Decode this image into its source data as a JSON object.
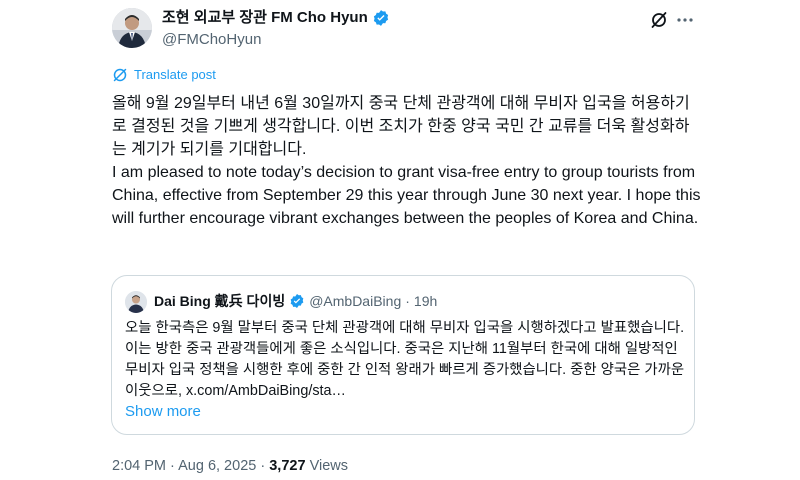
{
  "author": {
    "display_name": "조현 외교부 장관 FM Cho Hyun",
    "handle": "@FMChoHyun"
  },
  "translate_label": "Translate post",
  "body": {
    "korean": "올해 9월 29일부터 내년 6월 30일까지 중국 단체 관광객에 대해 무비자 입국을 허용하기로 결정된 것을 기쁘게 생각합니다. 이번 조치가 한중 양국 국민 간 교류를 더욱 활성화하는 계기가 되기를 기대합니다.",
    "english": "I am pleased to note today’s decision to grant visa-free entry to group tourists from China, effective from September 29 this year through June 30 next year. I hope this will further encourage vibrant exchanges between the peoples of Korea and China."
  },
  "quote": {
    "display_name": "Dai Bing 戴兵 다이빙",
    "handle": "@AmbDaiBing",
    "separator": "·",
    "time": "19h",
    "text": "오늘 한국측은 9월 말부터 중국 단체 관광객에 대해 무비자 입국을 시행하겠다고 발표했습니다. 이는 방한 중국 관광객들에게 좋은 소식입니다. 중국은 지난해 11월부터 한국에 대해 일방적인 무비자 입국 정책을 시행한 후에 중한 간 인적 왕래가 빠르게 증가했습니다. 중한 양국은 가까운 이웃으로, x.com/AmbDaiBing/sta…",
    "show_more": "Show more"
  },
  "meta": {
    "time": "2:04 PM",
    "separator": "·",
    "date": "Aug 6, 2025",
    "separator2": "·",
    "views_count": "3,727",
    "views_label": "Views"
  },
  "colors": {
    "accent": "#1d9bf0",
    "text": "#0f1419",
    "secondary": "#536471",
    "border": "#cfd9de"
  },
  "icons": {
    "verified": "verified-badge-icon",
    "grok": "grok-icon",
    "more": "more-dots-icon",
    "translate": "translate-icon"
  }
}
